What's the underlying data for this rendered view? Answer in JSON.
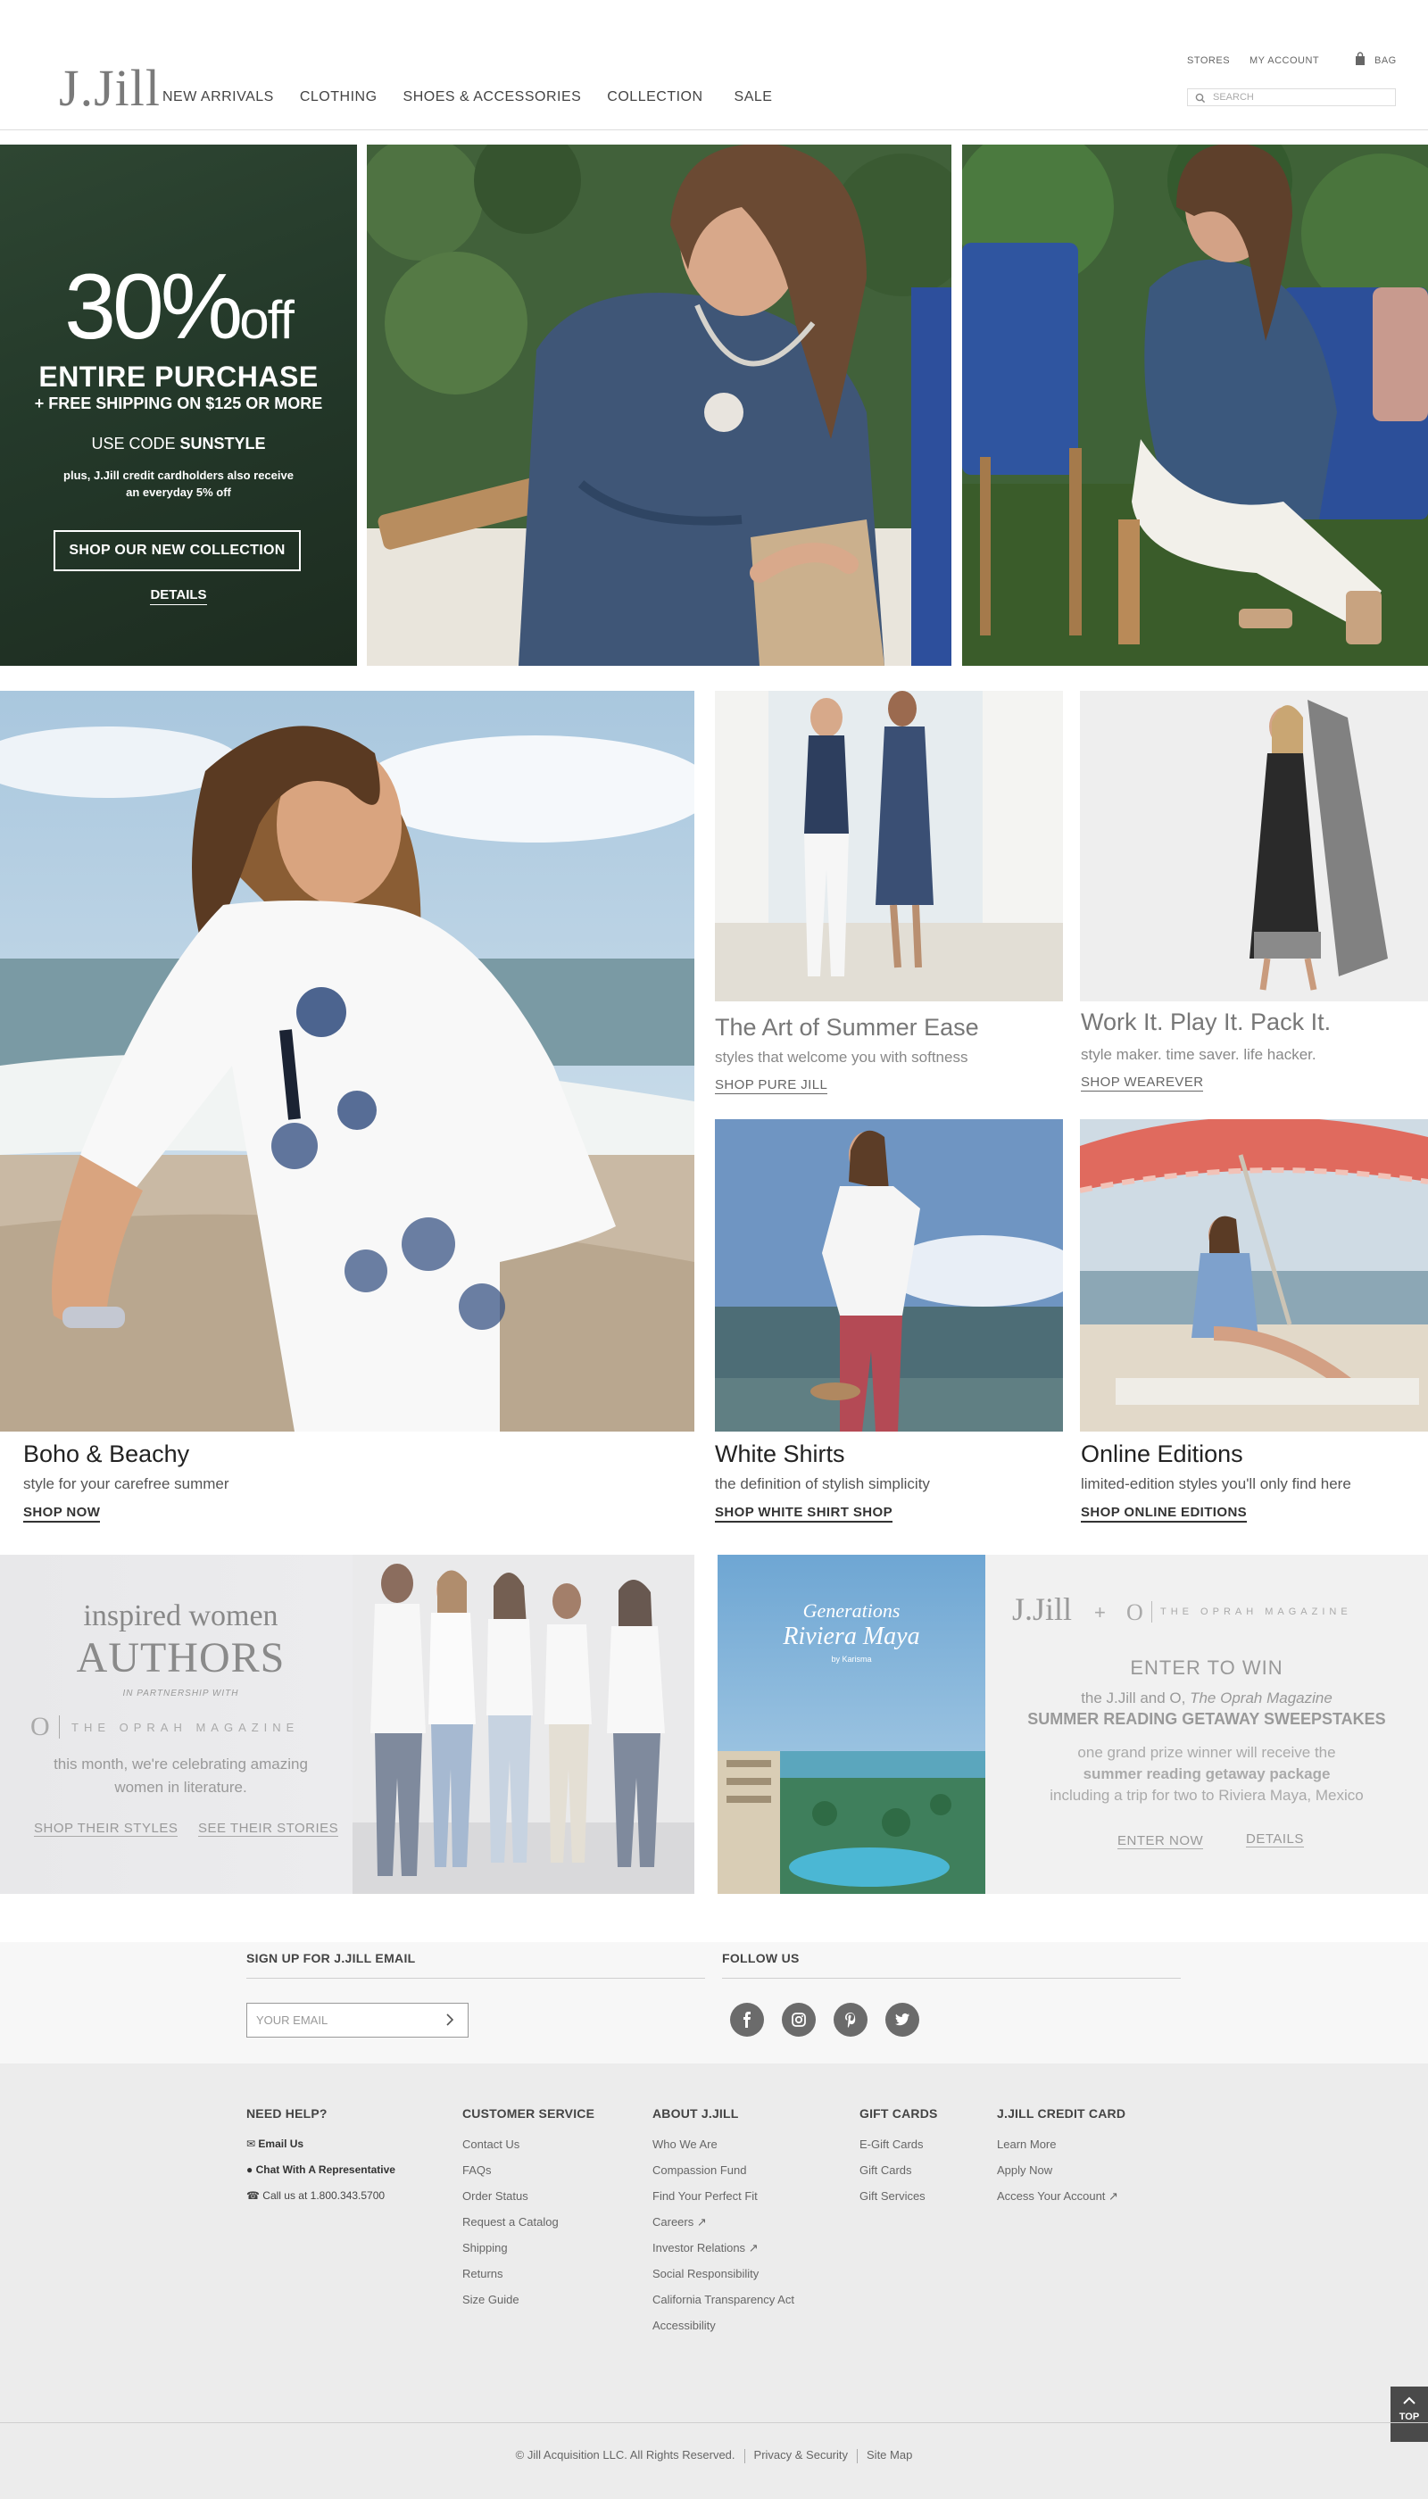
{
  "header": {
    "logo": "J.Jill",
    "nav": [
      "NEW ARRIVALS",
      "CLOTHING",
      "SHOES & ACCESSORIES",
      "COLLECTION",
      "SALE"
    ],
    "util": {
      "stores": "STORES",
      "account": "MY ACCOUNT",
      "bag": "BAG"
    },
    "search_placeholder": "SEARCH"
  },
  "hero": {
    "percent": "30%",
    "off": "off",
    "entire": "ENTIRE PURCHASE",
    "shipping": "+ FREE SHIPPING ON $125 OR MORE",
    "use_code": "USE CODE",
    "code": "SUNSTYLE",
    "card_note": "plus, J.Jill credit cardholders also receive an everyday 5% off",
    "cta": "SHOP OUR NEW COLLECTION",
    "details": "DETAILS"
  },
  "tiles": {
    "boho": {
      "title": "Boho & Beachy",
      "sub": "style for your carefree summer",
      "link": "SHOP NOW"
    },
    "summer": {
      "title": "The Art of Summer Ease",
      "sub": "styles that welcome you with softness",
      "link": "SHOP PURE JILL"
    },
    "work": {
      "title": "Work It. Play It. Pack It.",
      "sub": "style maker. time saver. life hacker.",
      "link": "SHOP  WEAREVER"
    },
    "white": {
      "title": "White Shirts",
      "sub": "the definition of stylish simplicity",
      "link": "SHOP WHITE SHIRT SHOP"
    },
    "online": {
      "title": "Online Editions",
      "sub": "limited-edition styles you'll only find here",
      "link": "SHOP ONLINE EDITIONS"
    }
  },
  "authors": {
    "kicker": "inspired women",
    "title": "AUTHORS",
    "partner": "IN PARTNERSHIP WITH",
    "o_mark": "O",
    "magazine": "THE OPRAH MAGAZINE",
    "body": "this month, we're celebrating amazing women in literature.",
    "link1": "SHOP THEIR STYLES",
    "link2": "SEE THEIR STORIES"
  },
  "sweeps": {
    "brand": "J.Jill",
    "plus": "+",
    "o_mark": "O",
    "magazine": "THE OPRAH MAGAZINE",
    "heading": "ENTER TO WIN",
    "line1_pre": "the J.Jill and O,",
    "line1_em": "The Oprah Magazine",
    "line2": "SUMMER READING GETAWAY SWEEPSTAKES",
    "line3": "one grand prize winner will receive the",
    "line4": "summer reading getaway package",
    "line5": "including a trip for two to Riviera Maya, Mexico",
    "enter": "ENTER NOW",
    "details": "DETAILS",
    "resort_line1": "Generations",
    "resort_line2": "Riviera Maya",
    "resort_line3": "by Karisma"
  },
  "band": {
    "email_label": "SIGN UP FOR J.JILL EMAIL",
    "email_placeholder": "YOUR EMAIL",
    "follow_label": "FOLLOW US"
  },
  "footer": {
    "help": {
      "title": "NEED HELP?",
      "items": [
        "Email Us",
        "Chat With A Representative",
        "Call us at 1.800.343.5700"
      ]
    },
    "service": {
      "title": "CUSTOMER SERVICE",
      "items": [
        "Contact Us",
        "FAQs",
        "Order Status",
        "Request a Catalog",
        "Shipping",
        "Returns",
        "Size Guide"
      ]
    },
    "about": {
      "title": "ABOUT J.JILL",
      "items": [
        "Who We Are",
        "Compassion Fund",
        "Find Your Perfect Fit",
        "Careers",
        "Investor Relations",
        "Social Responsibility",
        "California Transparency Act",
        "Accessibility"
      ]
    },
    "gift": {
      "title": "GIFT CARDS",
      "items": [
        "E-Gift Cards",
        "Gift Cards",
        "Gift Services"
      ]
    },
    "credit": {
      "title": "J.JILL CREDIT CARD",
      "items": [
        "Learn More",
        "Apply Now",
        "Access Your Account"
      ]
    },
    "copyright": "© Jill Acquisition LLC. All Rights Reserved.",
    "privacy": "Privacy & Security",
    "sitemap": "Site Map",
    "top": "TOP"
  },
  "colors": {
    "promo_green": "#24392a",
    "text_dark": "#222222",
    "footer_bg": "#ececec"
  }
}
